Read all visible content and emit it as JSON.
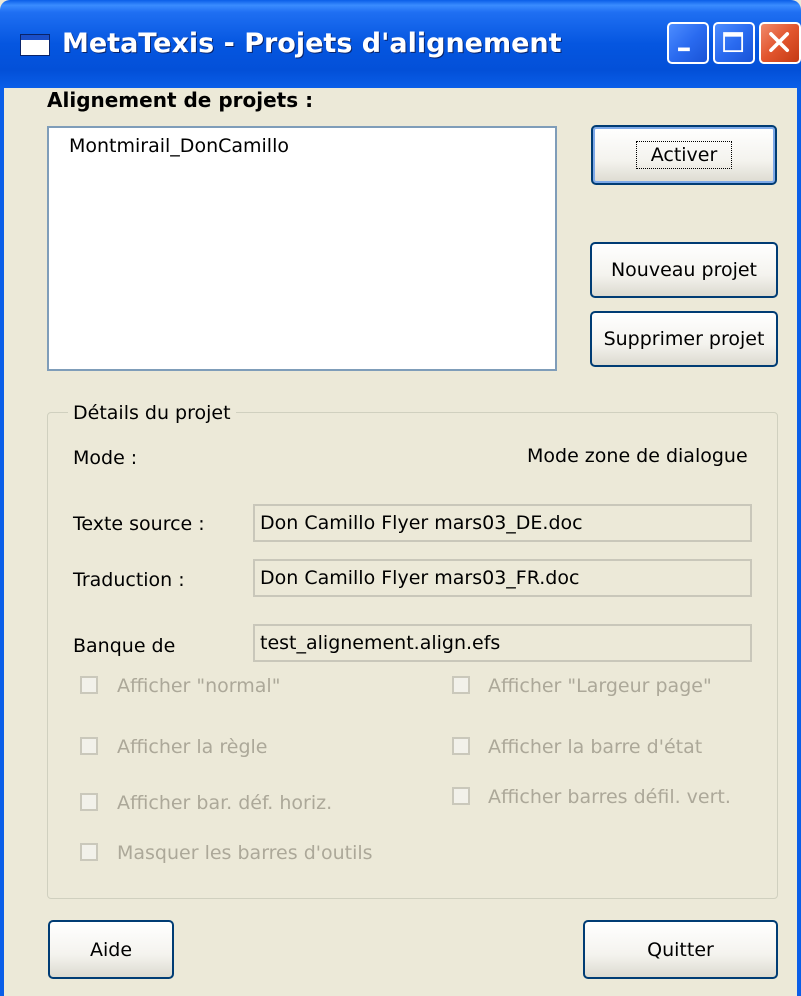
{
  "window": {
    "title": "MetaTexis - Projets d'alignement"
  },
  "projects": {
    "heading": "Alignement de projets :",
    "items": [
      "Montmirail_DonCamillo"
    ]
  },
  "buttons": {
    "activate": "Activer",
    "new_project": "Nouveau projet",
    "delete_project": "Supprimer projet",
    "help": "Aide",
    "quit": "Quitter"
  },
  "details": {
    "legend": "Détails du projet",
    "mode_label": "Mode :",
    "mode_value": "Mode zone de dialogue",
    "source_label": "Texte source :",
    "source_value": "Don Camillo Flyer mars03_DE.doc",
    "translation_label": "Traduction :",
    "translation_value": "Don Camillo Flyer mars03_FR.doc",
    "bank_label": "Banque de",
    "bank_value": "test_alignement.align.efs"
  },
  "options": {
    "show_normal": "Afficher \"normal\"",
    "show_page_width": "Afficher \"Largeur page\"",
    "show_ruler": "Afficher la règle",
    "show_status_bar": "Afficher la barre d'état",
    "show_hscroll": "Afficher bar. déf. horiz.",
    "show_vscroll": "Afficher barres défil. vert.",
    "hide_toolbars": "Masquer les barres d'outils"
  },
  "icons": {
    "app": "window-icon",
    "minimize": "minimize-icon",
    "maximize": "maximize-icon",
    "close": "close-icon"
  }
}
